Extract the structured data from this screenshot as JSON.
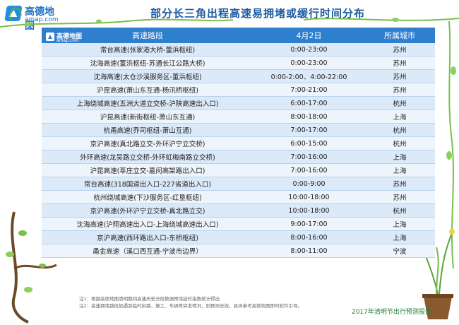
{
  "brand": {
    "name": "高德地图",
    "url": "amap.com"
  },
  "title": "部分长三角出程高速易拥堵或缓行时间分布",
  "table": {
    "headers": [
      "高速路段",
      "4月2日",
      "所属城市"
    ],
    "rows": [
      [
        "常台高速(张家港大桥-董浜枢纽)",
        "0:00-23:00",
        "苏州"
      ],
      [
        "沈海高速(董浜枢纽-苏通长江公路大桥)",
        "0:00-23:00",
        "苏州"
      ],
      [
        "沈海高速(太仓沙溪服务区-董浜枢纽)",
        "0:00-2:00、4:00-22:00",
        "苏州"
      ],
      [
        "沪昆高速(萧山东互通-杨汛桥枢纽)",
        "7:00-21:00",
        "苏州"
      ],
      [
        "上海绕城高速(五洲大道立交桥-沪陕高速出入口)",
        "6:00-17:00",
        "杭州"
      ],
      [
        "沪昆高速(新街枢纽-萧山东互通)",
        "8:00-18:00",
        "上海"
      ],
      [
        "杭甬高速(乔司枢纽-萧山互通)",
        "7:00-17:00",
        "杭州"
      ],
      [
        "京沪高速(真北路立交-外环沪宁立交桥)",
        "6:00-15:00",
        "杭州"
      ],
      [
        "外环高速(龙吴路立交桥-外环虹梅南路立交桥)",
        "7:00-16:00",
        "上海"
      ],
      [
        "沪昆高速(莘庄立交-嘉闵高架路出入口)",
        "7:00-16:00",
        "上海"
      ],
      [
        "常台高速(318国道出入口-227省道出入口)",
        "0:00-9:00",
        "苏州"
      ],
      [
        "杭州绕城高速(下沙服务区-红垦枢纽)",
        "10:00-18:00",
        "苏州"
      ],
      [
        "京沪高速(外环沪宁立交桥-真北路立交)",
        "10:00-18:00",
        "杭州"
      ],
      [
        "沈海高速(沪翔高速出入口-上海绕城高速出入口)",
        "9:00-17:00",
        "上海"
      ],
      [
        "京沪高速(西环路出入口-东桥枢纽)",
        "8:00-16:00",
        "上海"
      ],
      [
        "甬金高速（溪口西互通-宁波市边界）",
        "8:00-11:00",
        "宁波"
      ]
    ]
  },
  "notes": [
    "注1：根据高德地图清明期间高速历史分段数据预堵延时指数统计得出",
    "注2：高速拥堵路段如遇到临时封路、施工、车祸等突发情况，则预测无效，具体参考高德地图即时软件引导。"
  ],
  "footer": "2017年清明节出行预测报告",
  "colors": {
    "header": "#2f7fcf",
    "title": "#1d5aa0",
    "row_odd": "#dbe9f8",
    "row_even": "#eef4fb",
    "footer": "#2a7f3a"
  }
}
